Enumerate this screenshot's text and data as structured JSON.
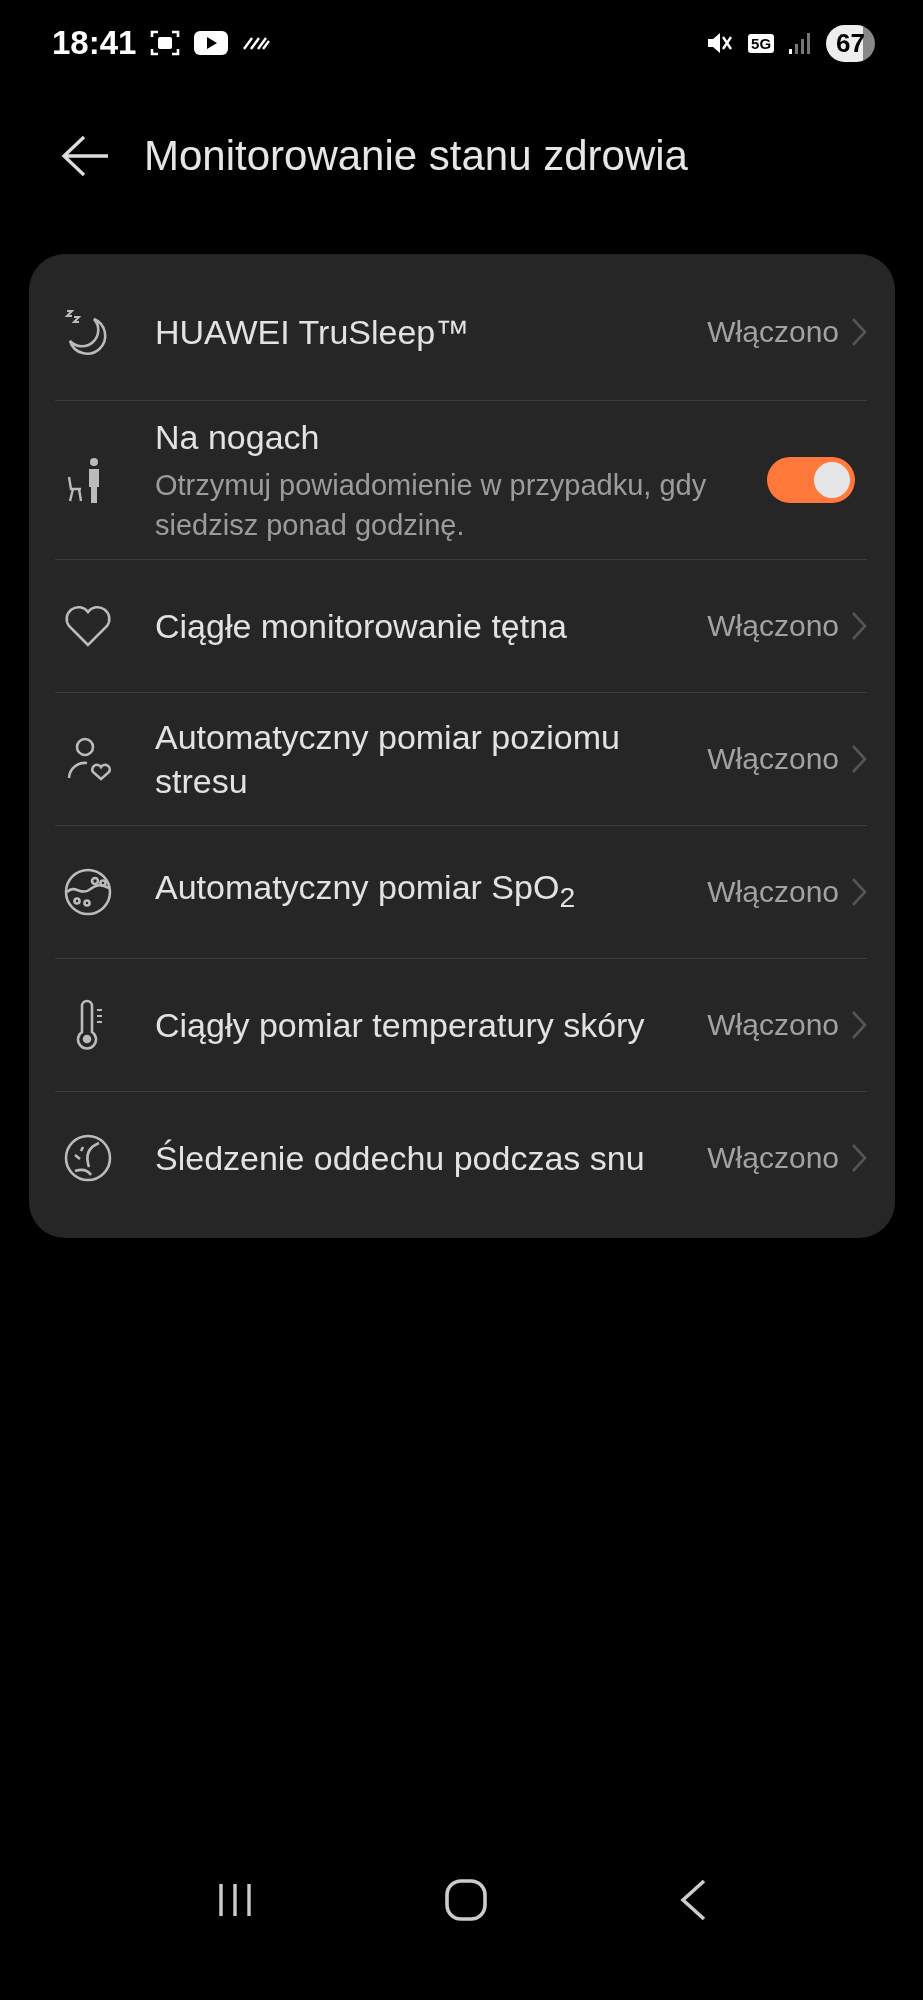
{
  "status_bar": {
    "time": "18:41",
    "network": "5G",
    "battery": "67"
  },
  "header": {
    "title": "Monitorowanie stanu zdrowia"
  },
  "items": [
    {
      "kind": "link",
      "title": "HUAWEI TruSleep™",
      "value": "Włączono"
    },
    {
      "kind": "switch",
      "title": "Na nogach",
      "description": "Otrzymuj powiadomienie w przypadku, gdy siedzisz ponad godzinę.",
      "on": true
    },
    {
      "kind": "link",
      "title": "Ciągłe monitorowanie tętna",
      "value": "Włączono"
    },
    {
      "kind": "link",
      "title": "Automatyczny pomiar poziomu stresu",
      "value": "Włączono"
    },
    {
      "kind": "link",
      "title": "Automatyczny pomiar SpO$_{2}$",
      "value": "Włączono"
    },
    {
      "kind": "link",
      "title": "Ciągły pomiar temperatury skóry",
      "value": "Włączono"
    },
    {
      "kind": "link",
      "title": "Śledzenie oddechu podczas snu",
      "value": "Włączono"
    }
  ]
}
